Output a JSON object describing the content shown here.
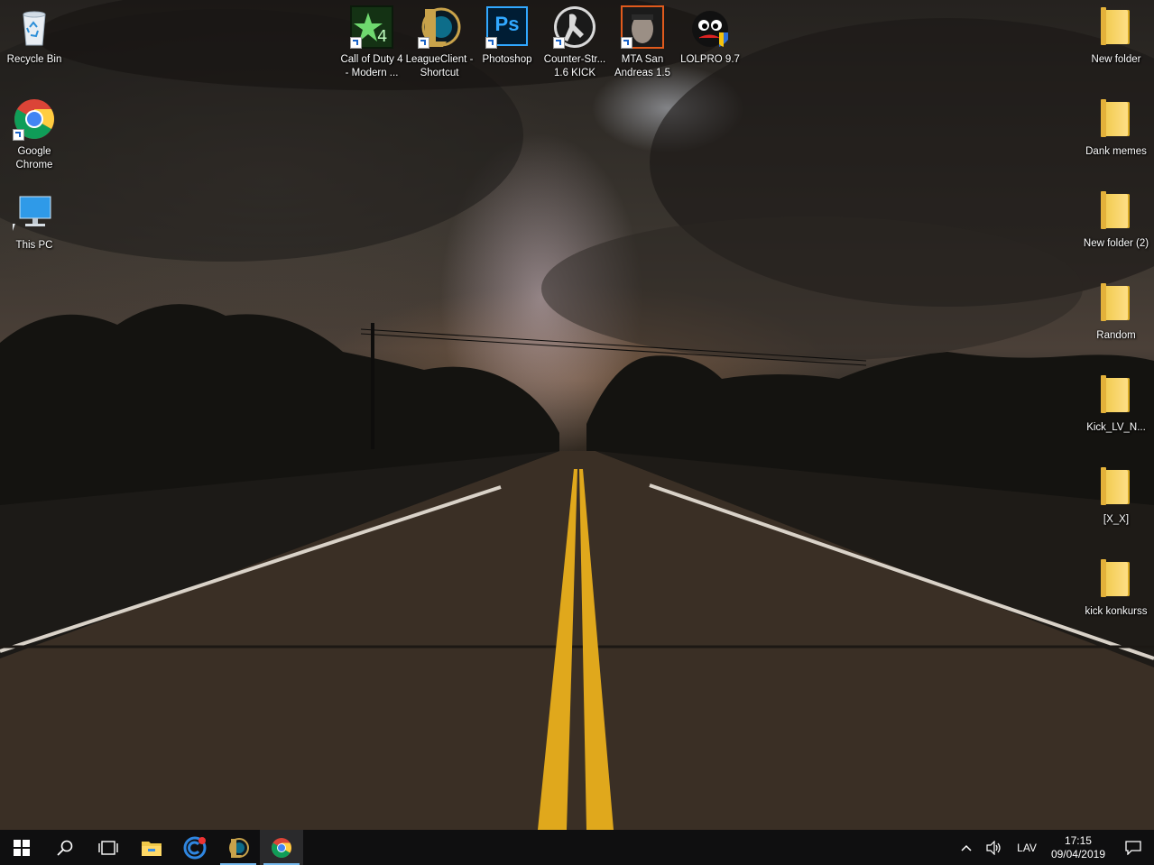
{
  "desktop": {
    "left_icons": [
      {
        "label": "Recycle Bin",
        "icon": "recycle-bin-icon",
        "shortcut": false
      },
      {
        "label": "Google Chrome",
        "icon": "chrome-icon",
        "shortcut": true
      },
      {
        "label": "This PC",
        "icon": "computer-icon",
        "shortcut": false
      }
    ],
    "top_icons": [
      {
        "label": "Call of Duty 4 - Modern ...",
        "icon": "cod4-icon",
        "shortcut": true
      },
      {
        "label": "LeagueClient - Shortcut",
        "icon": "league-icon",
        "shortcut": true
      },
      {
        "label": "Photoshop",
        "icon": "photoshop-icon",
        "shortcut": true,
        "badge": "Ps"
      },
      {
        "label": "Counter-Str... 1.6 KICK",
        "icon": "counter-strike-icon",
        "shortcut": true
      },
      {
        "label": "MTA San Andreas 1.5",
        "icon": "mta-icon",
        "shortcut": true
      },
      {
        "label": "LOLPRO 9.7",
        "icon": "lolpro-icon",
        "shortcut": false
      }
    ],
    "right_icons": [
      {
        "label": "New folder"
      },
      {
        "label": "Dank memes"
      },
      {
        "label": "New folder (2)"
      },
      {
        "label": "Random"
      },
      {
        "label": "Kick_LV_N..."
      },
      {
        "label": "[X_X]"
      },
      {
        "label": "kick konkurss"
      }
    ]
  },
  "taskbar": {
    "buttons": [
      {
        "name": "start-button",
        "icon": "windows-icon"
      },
      {
        "name": "search-button",
        "icon": "search-icon"
      },
      {
        "name": "task-view-button",
        "icon": "task-view-icon"
      },
      {
        "name": "file-explorer-button",
        "icon": "folder-icon"
      },
      {
        "name": "ccleaner-button",
        "icon": "ccleaner-icon"
      },
      {
        "name": "league-taskbar-button",
        "icon": "league-icon"
      },
      {
        "name": "chrome-taskbar-button",
        "icon": "chrome-icon"
      }
    ],
    "tray": {
      "language": "LAV",
      "time": "17:15",
      "date": "09/04/2019"
    }
  },
  "colors": {
    "taskbar_bg": "#0f0f10",
    "running_indicator": "#76b9ed",
    "folder_yellow": "#f0c94a"
  }
}
